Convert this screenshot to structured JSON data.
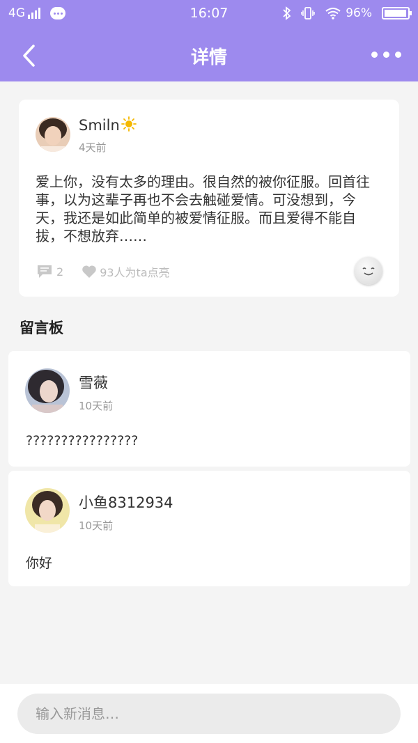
{
  "status_bar": {
    "network": "4G",
    "time": "16:07",
    "battery": "96%",
    "battery_level": 0.96
  },
  "nav": {
    "title": "详情"
  },
  "post": {
    "author": "Smiln",
    "time": "4天前",
    "content": "爱上你，没有太多的理由。很自然的被你征服。回首往事，以为这辈子再也不会去触碰爱情。可没想到，今天，我还是如此简单的被爱情征服。而且爱得不能自拔，不想放弃……",
    "comment_count": "2",
    "like_text": "93人为ta点亮"
  },
  "board": {
    "title": "留言板",
    "comments": [
      {
        "name": "雪薇",
        "time": "10天前",
        "text": "????????????????"
      },
      {
        "name": "小鱼8312934",
        "time": "10天前",
        "text": "你好"
      }
    ]
  },
  "input": {
    "placeholder": "输入新消息…"
  },
  "colors": {
    "accent": "#9d8aee",
    "background": "#f4f4f4"
  }
}
